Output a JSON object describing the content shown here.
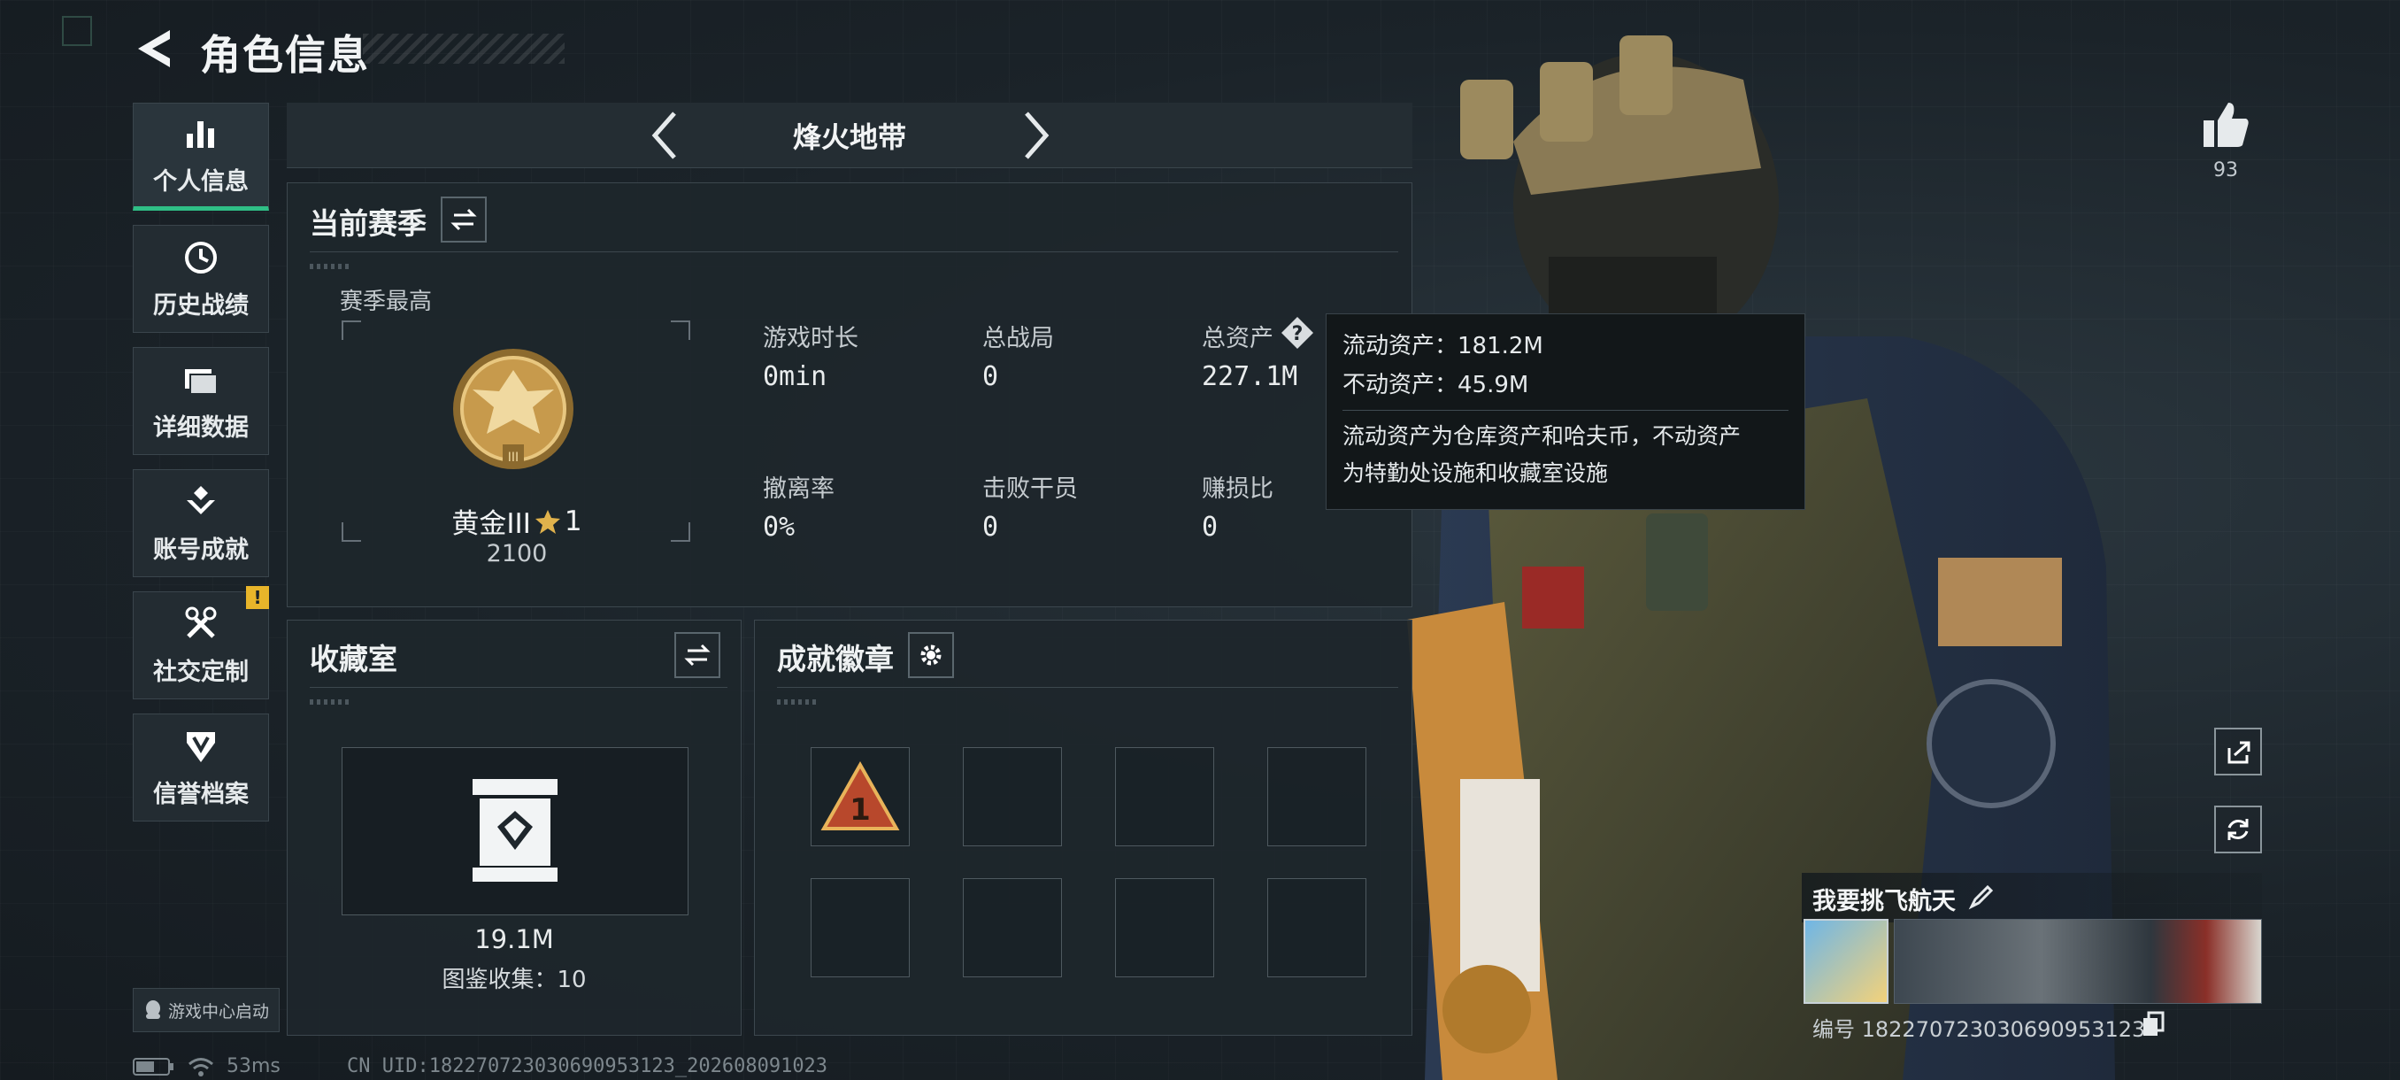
{
  "header": {
    "title": "角色信息"
  },
  "sidebar": {
    "items": [
      {
        "label": "个人信息",
        "icon": "bar-chart-icon",
        "active": true
      },
      {
        "label": "历史战绩",
        "icon": "history-icon"
      },
      {
        "label": "详细数据",
        "icon": "folder-icon"
      },
      {
        "label": "账号成就",
        "icon": "achievement-icon"
      },
      {
        "label": "社交定制",
        "icon": "tools-icon",
        "badge": "!"
      },
      {
        "label": "信誉档案",
        "icon": "credit-icon"
      }
    ],
    "game_center": "游戏中心启动"
  },
  "mode": {
    "title": "烽火地带"
  },
  "season": {
    "title": "当前赛季",
    "best_label": "赛季最高",
    "rank_name": "黄金III",
    "rank_stars": "1",
    "rank_points": "2100",
    "stats": [
      {
        "label": "游戏时长",
        "value": "0min"
      },
      {
        "label": "总战局",
        "value": "0"
      },
      {
        "label": "总资产",
        "value": "227.1M"
      },
      {
        "label": "撤离率",
        "value": "0%"
      },
      {
        "label": "击败干员",
        "value": "0"
      },
      {
        "label": "赚损比",
        "value": "0"
      }
    ]
  },
  "tooltip": {
    "liquid": "流动资产：181.2M",
    "fixed": "不动资产：45.9M",
    "desc_line1": "流动资产为仓库资产和哈夫币，不动资产",
    "desc_line2": "为特勤处设施和收藏室设施"
  },
  "collection": {
    "title": "收藏室",
    "value": "19.1M",
    "count_label": "图鉴收集：10"
  },
  "badges": {
    "title": "成就徽章",
    "first_badge_text": "1"
  },
  "profile": {
    "likes": "93",
    "name": "我要挑飞航天",
    "id_text": "编号 18227072303069095312​3"
  },
  "status": {
    "ping": "53ms",
    "uid": "CN UID:18227072303069095312​3_202608091023"
  },
  "colors": {
    "accent_green": "#2fbf86",
    "gold": "#c79a4c",
    "warning": "#e8b52a"
  }
}
